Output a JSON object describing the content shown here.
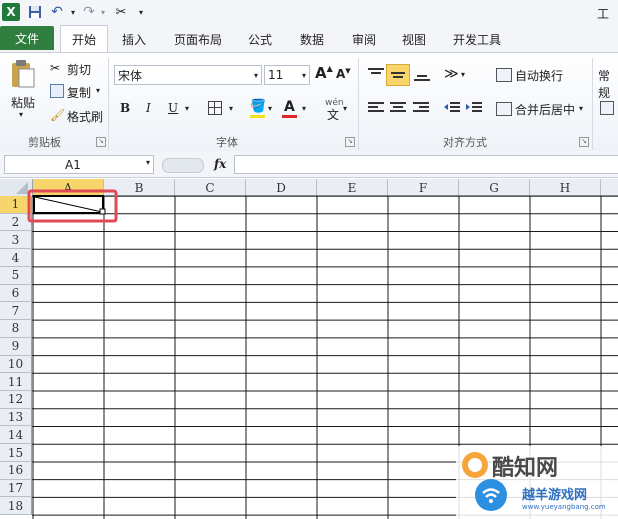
{
  "title": "工作",
  "quick_access": {
    "save_icon": "save-icon",
    "undo_icon": "undo-icon",
    "redo_icon": "redo-icon"
  },
  "tabs": {
    "file": "文件",
    "items": [
      "开始",
      "插入",
      "页面布局",
      "公式",
      "数据",
      "审阅",
      "视图",
      "开发工具"
    ]
  },
  "ribbon": {
    "clipboard": {
      "paste": "粘贴",
      "cut": "剪切",
      "copy": "复制",
      "format_painter": "格式刷",
      "label": "剪贴板"
    },
    "font": {
      "font_name": "宋体",
      "font_size": "11",
      "bold": "B",
      "italic": "I",
      "underline": "U",
      "grow": "A",
      "shrink": "A",
      "wen": "wén",
      "label": "字体"
    },
    "alignment": {
      "wrap_text": "自动换行",
      "merge_center": "合并后居中",
      "label": "对齐方式"
    },
    "number": {
      "format": "常规"
    }
  },
  "formula_bar": {
    "name_box": "A1",
    "fx": "fx",
    "value": ""
  },
  "columns": [
    "A",
    "B",
    "C",
    "D",
    "E",
    "F",
    "G",
    "H"
  ],
  "rows": [
    "1",
    "2",
    "3",
    "4",
    "5",
    "6",
    "7",
    "8",
    "9",
    "10",
    "11",
    "12",
    "13",
    "14",
    "15",
    "16",
    "17",
    "18"
  ],
  "watermark": {
    "text1": "酷知网",
    "text2": "越羊游戏网",
    "url": "www.yueyangbang.com"
  },
  "colors": {
    "file_tab": "#2f7d3f",
    "highlight": "#e04a55",
    "selected_header": "#f8d56b"
  }
}
